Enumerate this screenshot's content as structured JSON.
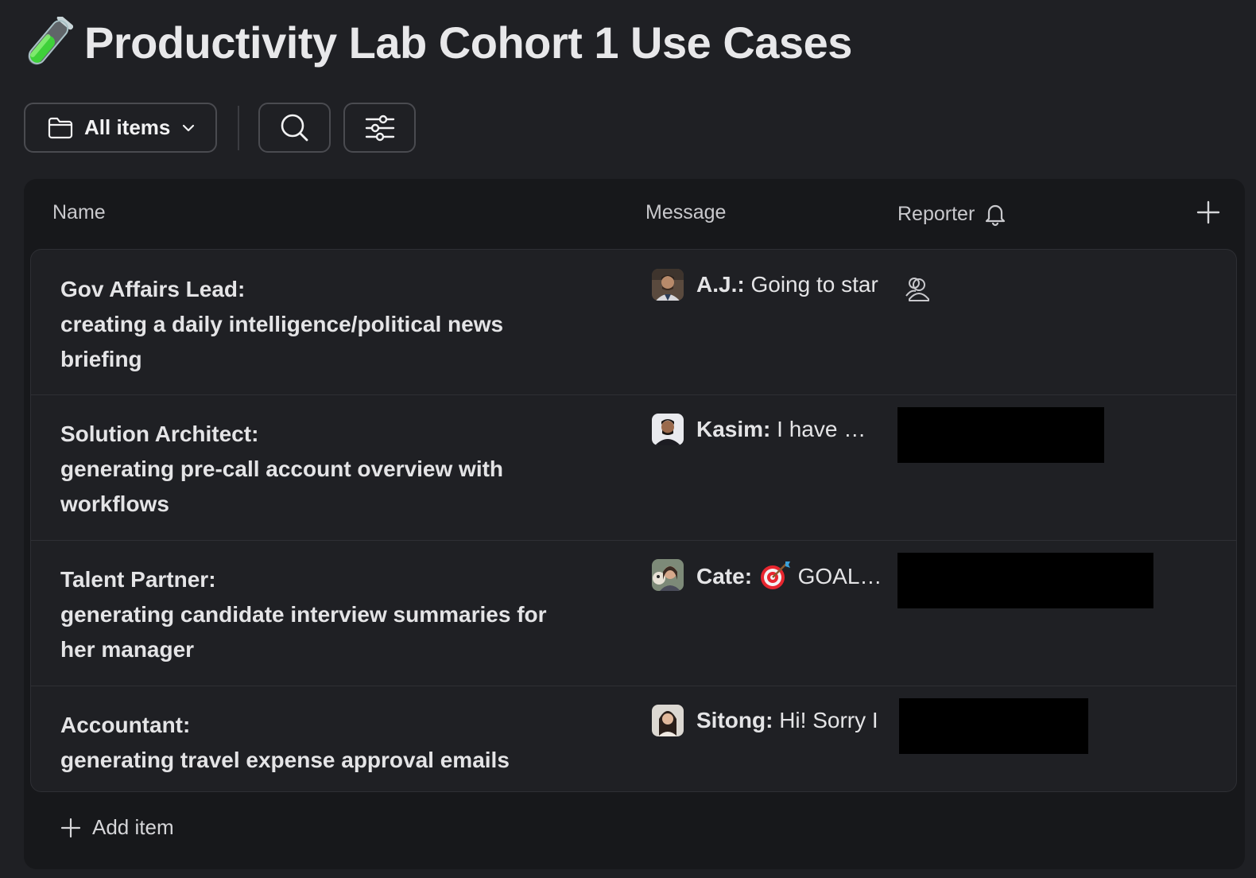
{
  "page": {
    "title": "Productivity Lab Cohort 1 Use Cases",
    "title_icon": "test-tube-emoji"
  },
  "toolbar": {
    "view_label": "All items",
    "view_icon": "folder-icon",
    "search_icon": "search-icon",
    "filter_icon": "sliders-icon"
  },
  "table": {
    "columns": {
      "name": "Name",
      "message": "Message",
      "reporter": "Reporter"
    },
    "rows": [
      {
        "role": "Gov Affairs Lead:",
        "description": "creating a daily intelligence/political news briefing",
        "author": "A.J.:",
        "message": "Going to star",
        "reporter_state": "empty"
      },
      {
        "role": "Solution Architect:",
        "description": "generating pre-call account overview with workflows",
        "author": "Kasim:",
        "message": "I have …",
        "reporter_state": "redacted"
      },
      {
        "role": "Talent Partner:",
        "description": "generating candidate interview summaries for her manager",
        "author": "Cate:",
        "message": "GOAL…",
        "message_emoji": "direct-hit-emoji",
        "reporter_state": "redacted"
      },
      {
        "role": "Accountant:",
        "description": "generating travel expense approval emails",
        "author": "Sitong:",
        "message": "Hi! Sorry I",
        "reporter_state": "redacted"
      }
    ],
    "add_item_label": "Add item"
  },
  "colors": {
    "background": "#1f2024",
    "panel": "#17181b",
    "border": "#2e2f34",
    "text": "#e4e4e6",
    "redaction": "#000000"
  }
}
